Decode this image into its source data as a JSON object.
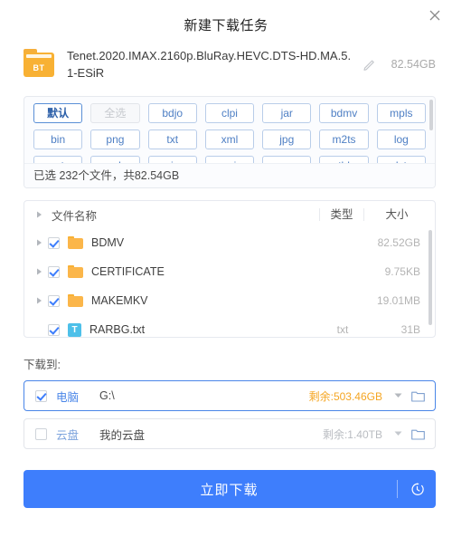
{
  "dialog": {
    "title": "新建下载任务",
    "close_label": "×"
  },
  "task": {
    "icon_label": "BT",
    "name": "Tenet.2020.IMAX.2160p.BluRay.HEVC.DTS-HD.MA.5.1-ESiR",
    "size": "82.54GB",
    "edit_tooltip": "编辑"
  },
  "tags": {
    "rows": [
      [
        {
          "label": "默认",
          "state": "active"
        },
        {
          "label": "全选",
          "state": "disabled"
        },
        {
          "label": "bdjo",
          "state": "normal"
        },
        {
          "label": "clpi",
          "state": "normal"
        },
        {
          "label": "jar",
          "state": "normal"
        },
        {
          "label": "bdmv",
          "state": "normal"
        },
        {
          "label": "mpls",
          "state": "normal"
        }
      ],
      [
        {
          "label": "bin",
          "state": "normal"
        },
        {
          "label": "png",
          "state": "normal"
        },
        {
          "label": "txt",
          "state": "normal"
        },
        {
          "label": "xml",
          "state": "normal"
        },
        {
          "label": "jpg",
          "state": "normal"
        },
        {
          "label": "m2ts",
          "state": "normal"
        },
        {
          "label": "log",
          "state": "normal"
        }
      ],
      [
        {
          "label": "crt",
          "state": "normal"
        },
        {
          "label": "crl",
          "state": "normal"
        },
        {
          "label": "sig",
          "state": "normal"
        },
        {
          "label": "cci",
          "state": "normal"
        },
        {
          "label": "cer",
          "state": "normal"
        },
        {
          "label": "tbl",
          "state": "normal"
        },
        {
          "label": "lst",
          "state": "normal"
        }
      ]
    ],
    "summary": "已选 232个文件，共82.54GB"
  },
  "filelist": {
    "headers": {
      "name": "文件名称",
      "type": "类型",
      "size": "大小"
    },
    "rows": [
      {
        "name": "BDMV",
        "type": "",
        "size": "82.52GB",
        "icon": "folder",
        "checked": true,
        "expandable": true
      },
      {
        "name": "CERTIFICATE",
        "type": "",
        "size": "9.75KB",
        "icon": "folder",
        "checked": true,
        "expandable": true
      },
      {
        "name": "MAKEMKV",
        "type": "",
        "size": "19.01MB",
        "icon": "folder",
        "checked": true,
        "expandable": true
      },
      {
        "name": "RARBG.txt",
        "type": "txt",
        "size": "31B",
        "icon": "txt",
        "checked": true,
        "expandable": false
      }
    ]
  },
  "download_to": {
    "label": "下载到:",
    "options": [
      {
        "kind": "电脑",
        "value": "G:\\",
        "free": "剩余:503.46GB",
        "selected": true
      },
      {
        "kind": "云盘",
        "value": "我的云盘",
        "free": "剩余:1.40TB",
        "selected": false
      }
    ]
  },
  "action": {
    "label": "立即下载",
    "timer_icon": "timer-icon"
  },
  "colors": {
    "primary": "#3E7EFC",
    "accent_orange": "#F5A623",
    "folder_orange": "#FBB64A",
    "txt_blue": "#4EC0E9",
    "tag_blue": "#4e7fc4"
  }
}
